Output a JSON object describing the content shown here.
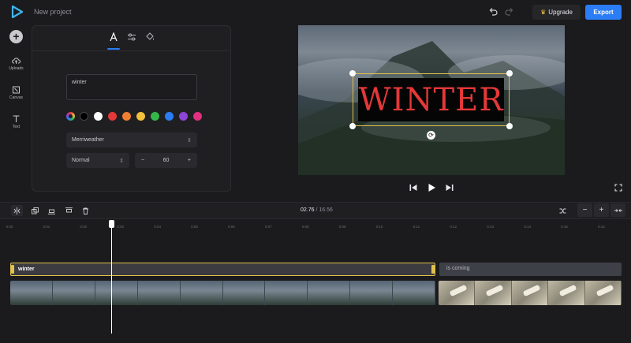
{
  "header": {
    "project_title": "New project",
    "upgrade_label": "Upgrade",
    "export_label": "Export",
    "accent": "#2b7df5"
  },
  "rail": {
    "items": [
      {
        "label": "Uploads",
        "icon": "upload-cloud-icon"
      },
      {
        "label": "Canvas",
        "icon": "canvas-icon"
      },
      {
        "label": "Text",
        "icon": "text-icon"
      }
    ]
  },
  "panel": {
    "tabs": [
      "text-tab",
      "adjust-tab",
      "fill-tab"
    ],
    "text_value": "winter",
    "swatches": [
      "#000000",
      "#ffffff",
      "#e53838",
      "#f07f32",
      "#f3c03c",
      "#35b54a",
      "#2b7df5",
      "#8e44d6",
      "#e0307f"
    ],
    "font": "Merriweather",
    "style": "Normal",
    "size": "60"
  },
  "preview": {
    "overlay_text": "WINTER"
  },
  "timeline": {
    "current_time": "02.76",
    "separator": "/",
    "total_time": "16.56",
    "ticks": [
      "0:00",
      "0:01",
      "0:02",
      "0:03",
      "0:04",
      "0:05",
      "0:06",
      "0:07",
      "0:08",
      "0:09",
      "0:10",
      "0:11",
      "0:12",
      "0:13",
      "0:14",
      "0:15",
      "0:16"
    ],
    "text_clip_1": "winter",
    "text_clip_2": "is coming"
  }
}
